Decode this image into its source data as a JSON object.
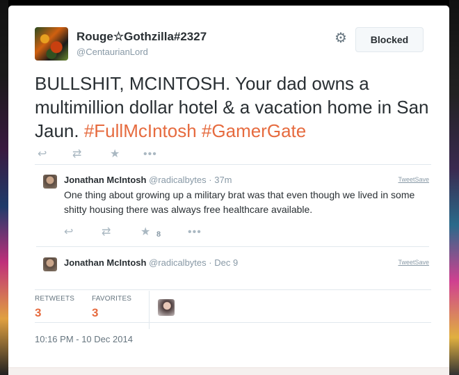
{
  "tweet": {
    "author_name": "Rouge☆Gothzilla#2327",
    "author_handle": "@CentaurianLord",
    "follow_button_label": "Blocked",
    "text_plain": "BULLSHIT, MCINTOSH. Your dad owns a multimillion dollar hotel & a vacation home in San Jaun.",
    "hashtag_1": "#FullMcIntosh",
    "hashtag_2": "#GamerGate",
    "retweets_label": "RETWEETS",
    "retweets_count": "3",
    "favorites_label": "FAVORITES",
    "favorites_count": "3",
    "timestamp": "10:16 PM - 10 Dec 2014"
  },
  "replies": [
    {
      "author_name": "Jonathan McIntosh",
      "author_handle": "@radicalbytes",
      "time": "· 37m",
      "tweetsave": "TweetSave",
      "text": "One thing about growing up a military brat was that even though we lived in some shitty housing there was always free healthcare available.",
      "favorites": "8"
    },
    {
      "author_name": "Jonathan McIntosh",
      "author_handle": "@radicalbytes",
      "time": "· Dec 9",
      "tweetsave": "TweetSave"
    }
  ],
  "icons": [
    "gear-icon",
    "reply-icon",
    "retweet-icon",
    "favorite-icon",
    "more-icon"
  ],
  "colors": {
    "hashtag": "#e66b3f",
    "text": "#292f33",
    "muted": "#8899a6"
  }
}
